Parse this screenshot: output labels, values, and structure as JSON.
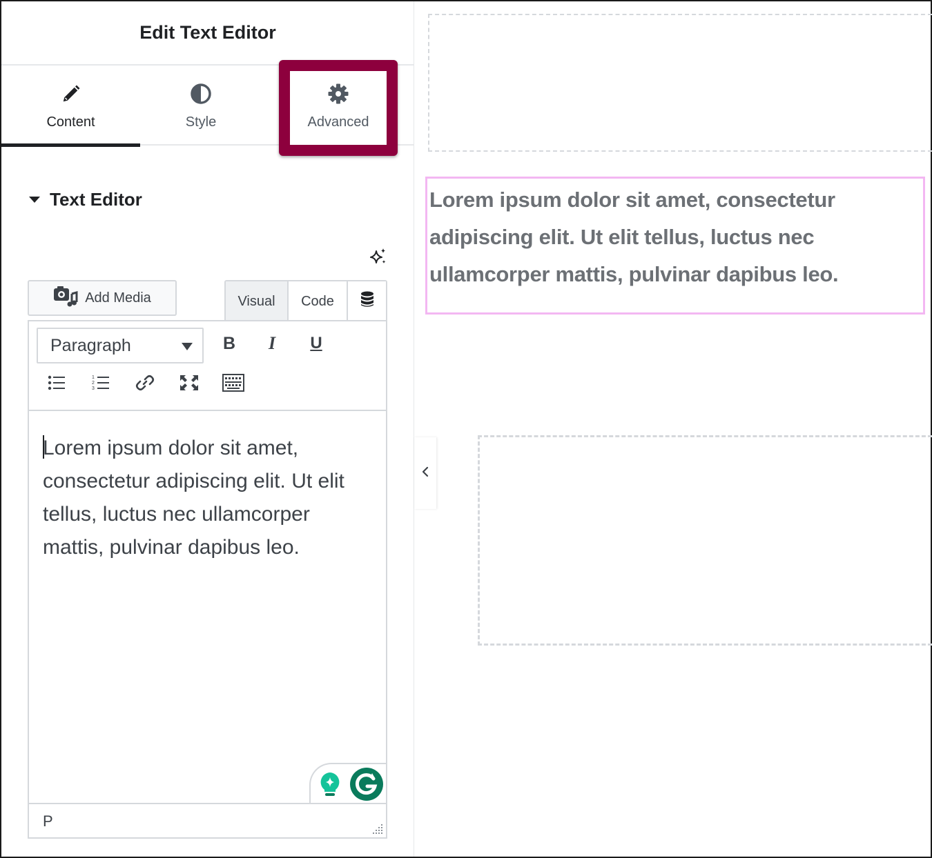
{
  "panel": {
    "title": "Edit Text Editor",
    "tabs": [
      {
        "label": "Content",
        "icon": "pencil-icon",
        "active": true
      },
      {
        "label": "Style",
        "icon": "half-circle-icon",
        "active": false
      },
      {
        "label": "Advanced",
        "icon": "gear-icon",
        "active": false,
        "highlighted": true
      }
    ],
    "section": {
      "title": "Text Editor",
      "expanded": true
    },
    "ai_icon": "sparkle-icon"
  },
  "editor": {
    "add_media_label": "Add Media",
    "modes": [
      "Visual",
      "Code"
    ],
    "active_mode": "Visual",
    "format_select": "Paragraph",
    "toolbar": {
      "bold": "B",
      "italic": "I",
      "underline": "U"
    },
    "content": "Lorem ipsum dolor sit amet, consectetur adipiscing elit. Ut elit tellus, luctus nec ullamcorper mattis, pulvinar dapibus leo.",
    "path": "P"
  },
  "preview": {
    "text": "Lorem ipsum dolor sit amet, consectetur adipiscing elit. Ut elit tellus, luctus nec ullamcorper mattis, pulvinar dapibus leo."
  },
  "colors": {
    "highlight_border": "#8d003d",
    "selection_outline": "#f3b7f2",
    "grammarly_green": "#15c39a",
    "grammarly_dark": "#0a7b5c"
  }
}
